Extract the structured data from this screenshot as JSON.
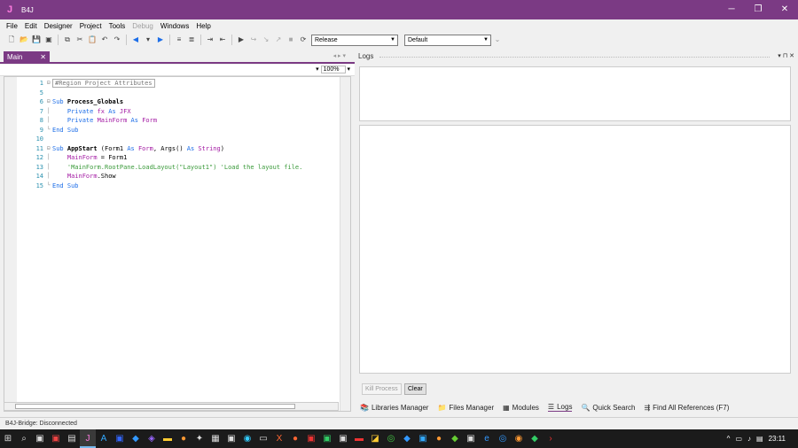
{
  "window": {
    "title": "B4J",
    "app_glyph": "J"
  },
  "menu": [
    "File",
    "Edit",
    "Designer",
    "Project",
    "Tools",
    "Debug",
    "Windows",
    "Help"
  ],
  "menu_disabled": [
    "Debug"
  ],
  "toolbar": {
    "build_config": "Release",
    "build_target": "Default"
  },
  "document_tab": {
    "label": "Main"
  },
  "editor": {
    "zoom": "100%",
    "lines": [
      {
        "n": "1",
        "html": "<span class='region'>#Region Project Attributes</span>"
      },
      {
        "n": "5",
        "html": ""
      },
      {
        "n": "6",
        "html": "<span class='kw'>Sub</span> <span class='fn'>Process_Globals</span>"
      },
      {
        "n": "7",
        "html": "    <span class='kw'>Private</span> <span class='var'>fx</span> <span class='kw'>As</span> <span class='type'>JFX</span>"
      },
      {
        "n": "8",
        "html": "    <span class='kw'>Private</span> <span class='var'>MainForm</span> <span class='kw'>As</span> <span class='type'>Form</span>"
      },
      {
        "n": "9",
        "html": "<span class='kw'>End Sub</span>"
      },
      {
        "n": "10",
        "html": ""
      },
      {
        "n": "11",
        "html": "<span class='kw'>Sub</span> <span class='fn'>AppStart</span> (Form1 <span class='kw'>As</span> <span class='type'>Form</span>, Args() <span class='kw'>As</span> <span class='type'>String</span>)"
      },
      {
        "n": "12",
        "html": "    <span class='var'>MainForm</span> = Form1"
      },
      {
        "n": "13",
        "html": "    <span class='cm'>'MainForm.RootPane.LoadLayout(\"Layout1\") 'Load the layout file.</span>"
      },
      {
        "n": "14",
        "html": "    <span class='var'>MainForm</span>.Show"
      },
      {
        "n": "15",
        "html": "<span class='kw'>End Sub</span>"
      }
    ]
  },
  "logs": {
    "title": "Logs",
    "kill_process_label": "Kill Process",
    "clear_label": "Clear"
  },
  "bottom_tabs": [
    {
      "label": "Libraries Manager",
      "icon": "books-icon"
    },
    {
      "label": "Files Manager",
      "icon": "folder-icon"
    },
    {
      "label": "Modules",
      "icon": "modules-icon"
    },
    {
      "label": "Logs",
      "icon": "logs-icon"
    },
    {
      "label": "Quick Search",
      "icon": "search-icon"
    },
    {
      "label": "Find All References (F7)",
      "icon": "find-references-icon"
    }
  ],
  "status": {
    "text": "B4J-Bridge: Disconnected"
  },
  "taskbar": {
    "clock": "23:11"
  },
  "colors": {
    "accent": "#7b3a84"
  }
}
